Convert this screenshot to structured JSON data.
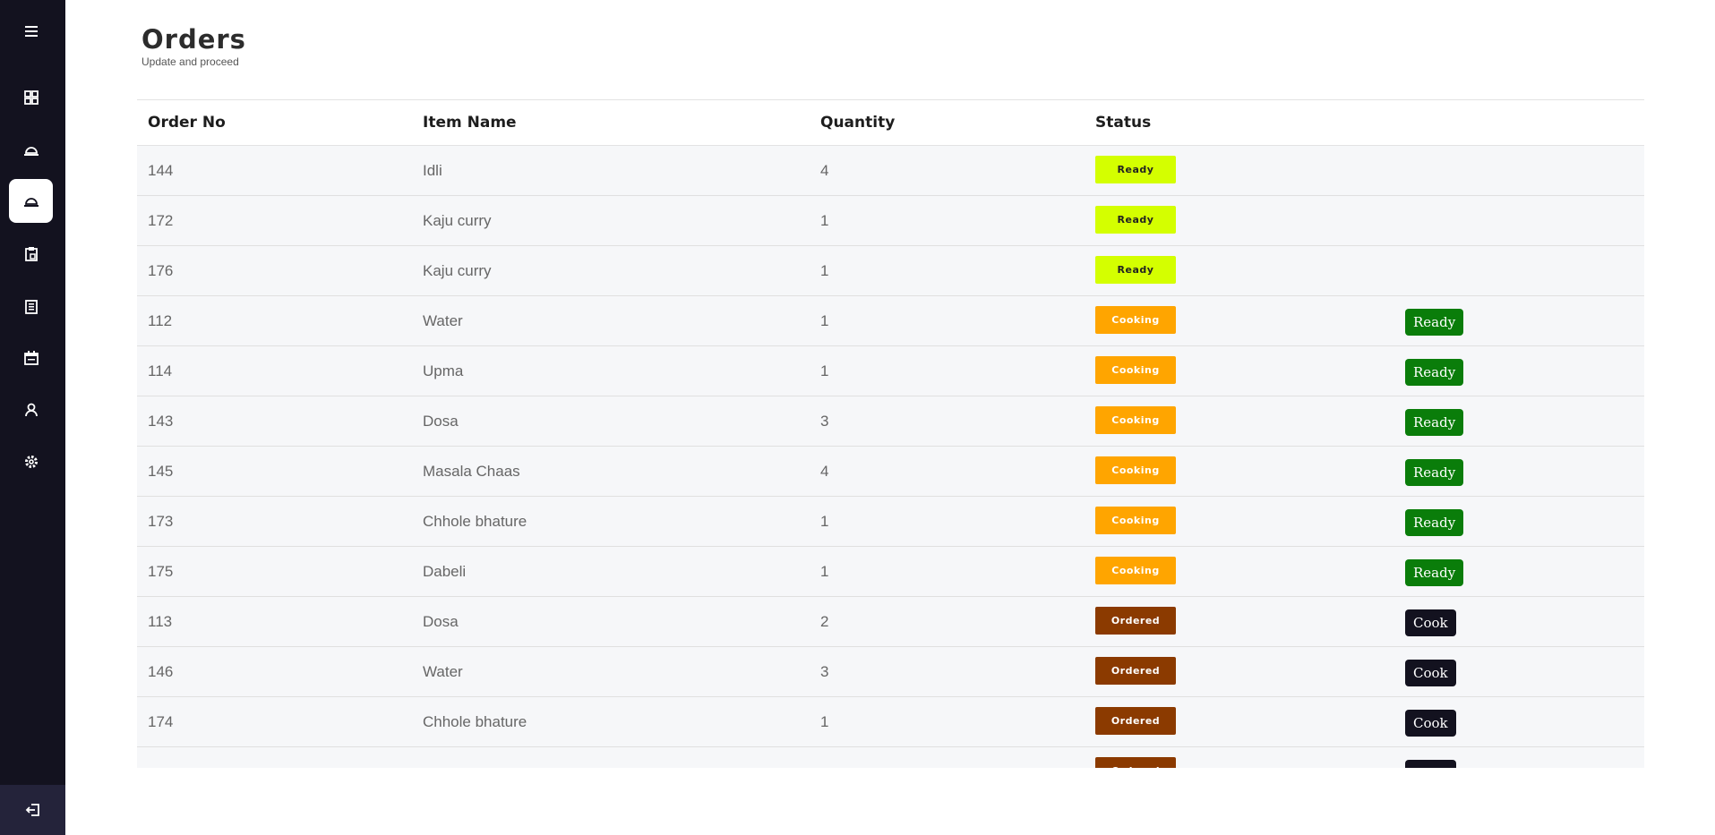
{
  "sidebar": {
    "items": [
      {
        "icon": "menu-icon"
      },
      {
        "icon": "dashboard-icon"
      },
      {
        "icon": "cloche-icon"
      },
      {
        "icon": "cloche-icon",
        "active": true
      },
      {
        "icon": "clipboard-icon"
      },
      {
        "icon": "book-icon"
      },
      {
        "icon": "calendar-icon"
      },
      {
        "icon": "user-icon"
      },
      {
        "icon": "gear-icon"
      }
    ],
    "logout_icon": "logout-icon"
  },
  "header": {
    "title": "Orders",
    "subtitle": "Update and proceed"
  },
  "table": {
    "columns": [
      "Order No",
      "Item Name",
      "Quantity",
      "Status",
      ""
    ],
    "rows": [
      {
        "order_no": "144",
        "item": "Idli",
        "qty": "4",
        "status": "Ready",
        "action": ""
      },
      {
        "order_no": "172",
        "item": "Kaju curry",
        "qty": "1",
        "status": "Ready",
        "action": ""
      },
      {
        "order_no": "176",
        "item": "Kaju curry",
        "qty": "1",
        "status": "Ready",
        "action": ""
      },
      {
        "order_no": "112",
        "item": "Water",
        "qty": "1",
        "status": "Cooking",
        "action": "Ready"
      },
      {
        "order_no": "114",
        "item": "Upma",
        "qty": "1",
        "status": "Cooking",
        "action": "Ready"
      },
      {
        "order_no": "143",
        "item": "Dosa",
        "qty": "3",
        "status": "Cooking",
        "action": "Ready"
      },
      {
        "order_no": "145",
        "item": "Masala Chaas",
        "qty": "4",
        "status": "Cooking",
        "action": "Ready"
      },
      {
        "order_no": "173",
        "item": "Chhole bhature",
        "qty": "1",
        "status": "Cooking",
        "action": "Ready"
      },
      {
        "order_no": "175",
        "item": "Dabeli",
        "qty": "1",
        "status": "Cooking",
        "action": "Ready"
      },
      {
        "order_no": "113",
        "item": "Dosa",
        "qty": "2",
        "status": "Ordered",
        "action": "Cook"
      },
      {
        "order_no": "146",
        "item": "Water",
        "qty": "3",
        "status": "Ordered",
        "action": "Cook"
      },
      {
        "order_no": "174",
        "item": "Chhole bhature",
        "qty": "1",
        "status": "Ordered",
        "action": "Cook"
      },
      {
        "order_no": "",
        "item": "",
        "qty": "",
        "status": "Ordered",
        "action": "Cook"
      }
    ]
  },
  "colors": {
    "sidebar_bg": "#13121f",
    "status_ready": "#d4ff00",
    "status_cooking": "#ffa500",
    "status_ordered": "#8b3a00",
    "action_ready": "#0a7d0a",
    "action_cook": "#13121f"
  }
}
